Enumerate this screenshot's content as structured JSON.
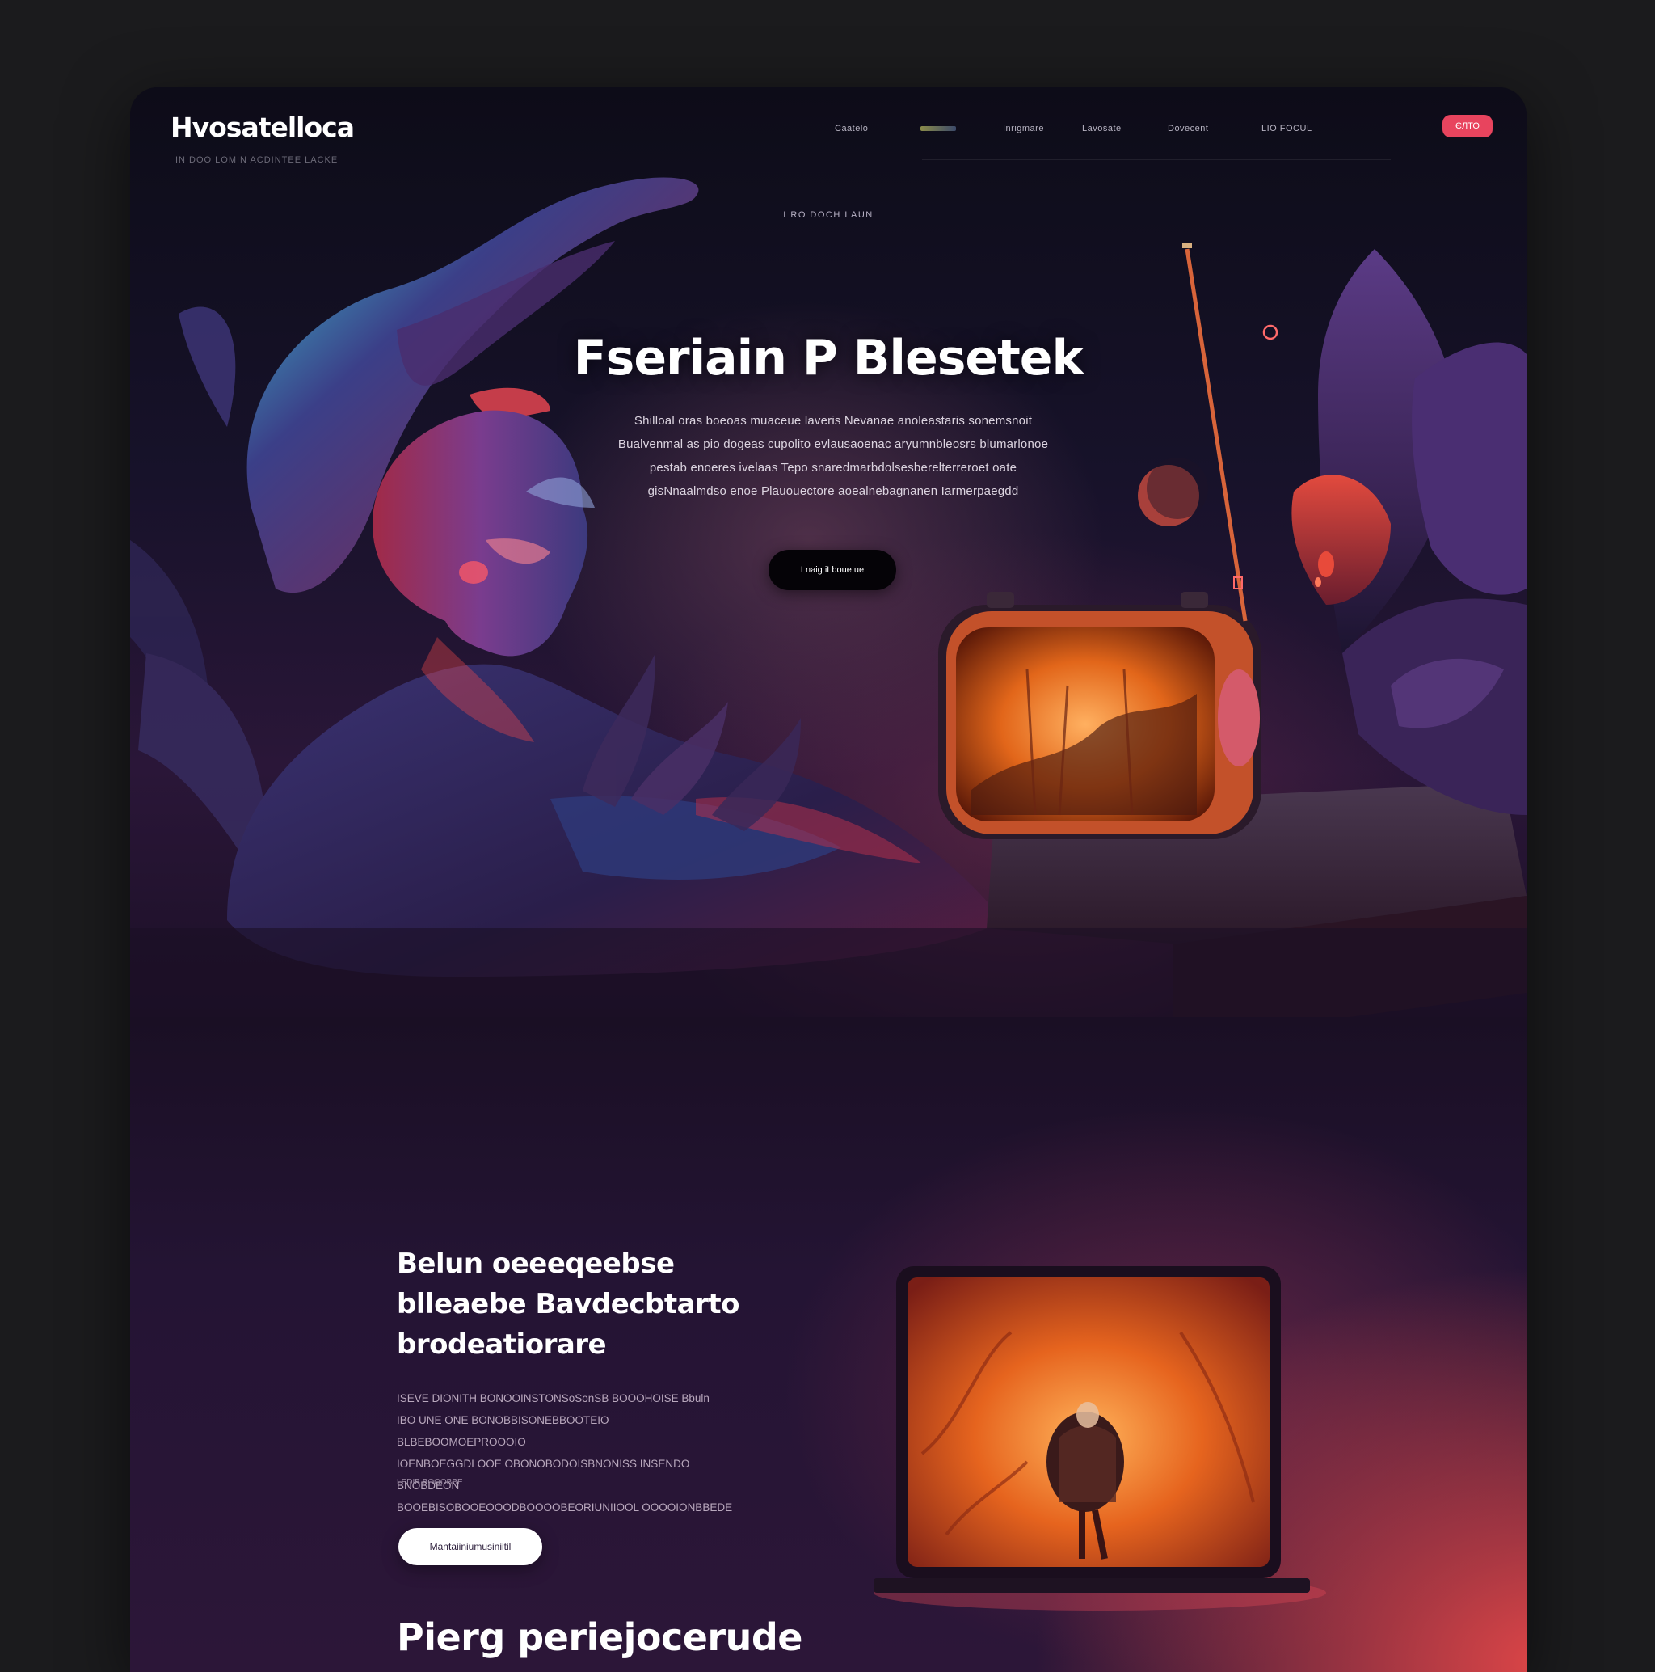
{
  "brand": {
    "logo": "Hvosatelloca",
    "tagline": "IN DOO LOMIN ACDINTEE LACKE"
  },
  "nav": {
    "items": [
      "Caatelo",
      "Inrigmare",
      "Lavosate",
      "Dovecent",
      "LIO FOCUL"
    ],
    "cta": "ЄЛТО"
  },
  "hero": {
    "eyebrow": "I RO DOCH LAUN",
    "title": "Fseriain P Blesetek",
    "body": [
      "Shilloal oras boeoas muaceue laveris Nevanae anoleastaris sonemsnoit",
      "Bualvenmal as pio dogeas cupolito evlausaoenac aryumnbleosrs blumarlonoe",
      "pestab enoeres ivelaas Tepo snaredmarbdolsesberelterreroet oate",
      "gisNnaalmdso enoe Plauouectore aoealnebagnanen Iarmerpaegdd"
    ],
    "cta": "Lnaig iLboue ue"
  },
  "feature": {
    "title_lines": [
      "Belun oeeeqeebse",
      "blleaebe Bavdecbtarto",
      "brodeatiorare"
    ],
    "body": [
      "ISEVE DIONITH BONOOINSTONSoSonSB BOOOHOISE Bbuln",
      "IBO UNE ONE BONOBBISONEBBOOTEIO BLBEBOOMOEPROOOIO",
      "IOENBOEGGDLOOE OBONOBODOISBNONISS INSENDO BNOBDEON",
      "BOOEBISOBOOEOOODBOOOOBEORIUNIIOOL OOOOIONBBEDE"
    ],
    "note": "LEDIB BOOOBBE",
    "cta": "Mantaiiniumusiniitil"
  },
  "bottom": {
    "title": "Pierg periejocerude"
  },
  "colors": {
    "accent": "#e8445e",
    "background": "#1b1b1d",
    "hero_glow": "#ff7a2a"
  }
}
